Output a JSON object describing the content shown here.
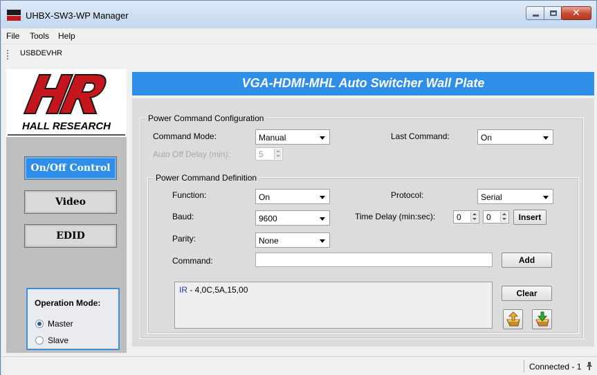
{
  "window": {
    "title": "UHBX-SW3-WP Manager",
    "icon": "hall-research-app-icon"
  },
  "menu": [
    "File",
    "Tools",
    "Help"
  ],
  "toolbar": {
    "device": "USBDEVHR"
  },
  "logo": {
    "caption": "HALL RESEARCH",
    "icon": "hall-research-logo"
  },
  "nav": {
    "items": [
      "On/Off Control",
      "Video",
      "EDID"
    ],
    "active_index": 0
  },
  "operation_mode": {
    "title": "Operation Mode:",
    "options": [
      "Master",
      "Slave"
    ],
    "selected": "Master"
  },
  "banner": {
    "title": "VGA-HDMI-MHL Auto Switcher Wall Plate"
  },
  "config": {
    "group_title": "Power Command Configuration",
    "command_mode_label": "Command Mode:",
    "command_mode_value": "Manual",
    "last_command_label": "Last Command:",
    "last_command_value": "On",
    "auto_off_label": "Auto Off Delay (min):",
    "auto_off_value": "5"
  },
  "definition": {
    "group_title": "Power Command Definition",
    "function_label": "Function:",
    "function_value": "On",
    "protocol_label": "Protocol:",
    "protocol_value": "Serial",
    "baud_label": "Baud:",
    "baud_value": "9600",
    "time_delay_label": "Time Delay (min:sec):",
    "time_delay_min": "0",
    "time_delay_sec": "0",
    "insert_label": "Insert",
    "parity_label": "Parity:",
    "parity_value": "None",
    "command_label": "Command:",
    "command_value": "",
    "add_label": "Add",
    "clear_label": "Clear",
    "list": [
      {
        "prefix": "IR",
        "text": " - 4,0C,5A,15,00"
      }
    ],
    "upload_icon": "upload-icon",
    "download_icon": "download-icon"
  },
  "status": {
    "connection": "Connected - 1",
    "icon": "pin-icon"
  },
  "colors": {
    "accent": "#2f8ee8",
    "logo_red": "#c4161c"
  }
}
